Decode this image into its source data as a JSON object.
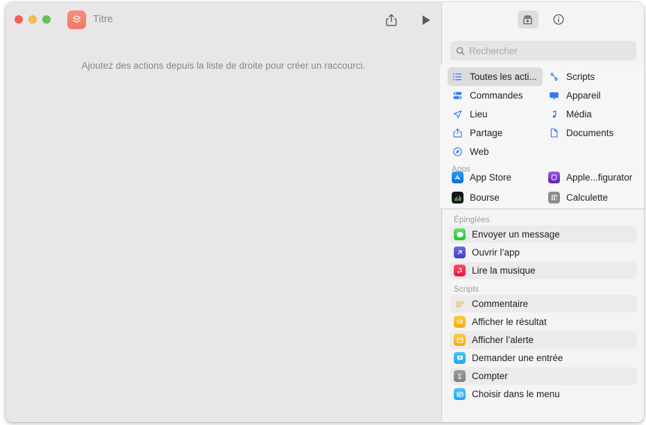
{
  "window": {
    "doc_title": "Titre",
    "app_icon_name": "shortcuts-app-icon",
    "canvas_hint": "Ajoutez des actions depuis la liste de droite pour créer un raccourci.",
    "traffic_lights": [
      "close",
      "minimize",
      "zoom"
    ],
    "toolbar": {
      "share_label": "Partager",
      "play_label": "Exécuter"
    }
  },
  "library": {
    "toolbar": {
      "action_library_label": "Bibliothèque d'actions",
      "info_label": "Infos sur le raccourci"
    },
    "search": {
      "placeholder": "Rechercher",
      "value": ""
    },
    "categories": [
      {
        "label": "Toutes les acti...",
        "icon": "list-bullet-icon",
        "selected": true
      },
      {
        "label": "Scripts",
        "icon": "scroll-icon",
        "selected": false
      },
      {
        "label": "Commandes",
        "icon": "sliders-icon",
        "selected": false
      },
      {
        "label": "Appareil",
        "icon": "display-icon",
        "selected": false
      },
      {
        "label": "Lieu",
        "icon": "location-arrow-icon",
        "selected": false
      },
      {
        "label": "Média",
        "icon": "music-note-icon",
        "selected": false
      },
      {
        "label": "Partage",
        "icon": "share-icon",
        "selected": false
      },
      {
        "label": "Documents",
        "icon": "document-icon",
        "selected": false
      },
      {
        "label": "Web",
        "icon": "safari-compass-icon",
        "selected": false
      }
    ],
    "apps_heading": "Apps",
    "apps": [
      {
        "label": "App Store",
        "icon": "app-store-icon",
        "color": "#1d8cf0"
      },
      {
        "label": "Apple...figurator",
        "icon": "apple-configurator-icon",
        "color": "#7b3fbf"
      },
      {
        "label": "Bourse",
        "icon": "stocks-icon",
        "color": "#1c1c1e"
      },
      {
        "label": "Calculette",
        "icon": "calculator-icon",
        "color": "#8e8e93"
      }
    ],
    "pinned_heading": "Épinglées",
    "pinned": [
      {
        "label": "Envoyer un message",
        "icon": "messages-icon",
        "color": "#4cd964",
        "zebra": true
      },
      {
        "label": "Ouvrir l’app",
        "icon": "open-app-icon",
        "color": "#5455d8",
        "zebra": false
      },
      {
        "label": "Lire la musique",
        "icon": "music-icon",
        "color": "#fa2d55",
        "zebra": true
      }
    ],
    "scripts_heading": "Scripts",
    "scripts": [
      {
        "label": "Commentaire",
        "icon": "comment-lines-icon",
        "color": "#f5b919",
        "zebra": true
      },
      {
        "label": "Afficher le résultat",
        "icon": "show-result-icon",
        "color": "#fcc019",
        "zebra": false
      },
      {
        "label": "Afficher l’alerte",
        "icon": "show-alert-icon",
        "color": "#fcc019",
        "zebra": true
      },
      {
        "label": "Demander une entrée",
        "icon": "ask-input-icon",
        "color": "#35b9f5",
        "zebra": false
      },
      {
        "label": "Compter",
        "icon": "count-sigma-icon",
        "color": "#8e8e93",
        "zebra": true
      },
      {
        "label": "Choisir dans le menu",
        "icon": "choose-menu-icon",
        "color": "#35b9f5",
        "zebra": false
      }
    ]
  },
  "colors": {
    "window_bg": "#e8e6e6",
    "sidebar_bg": "#f5f4f4",
    "popover_bg": "#f7f6f6",
    "accent_blue": "#3478f6",
    "selection_grey": "#dddcdc",
    "app_icon_coral": "#ec7a68"
  }
}
